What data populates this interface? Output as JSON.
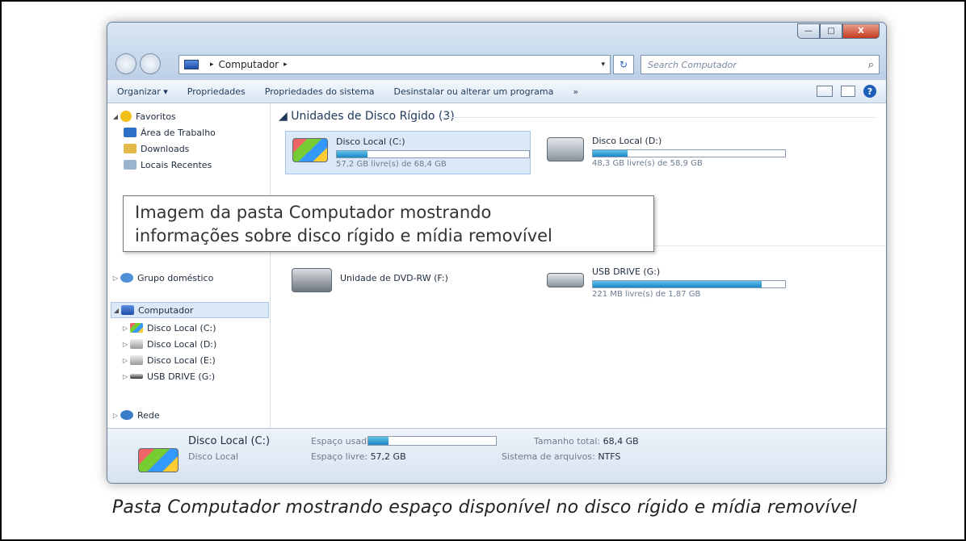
{
  "window": {
    "title_buttons": {
      "minimize": "—",
      "maximize": "□",
      "close": "X"
    },
    "address": {
      "path": [
        "Computador"
      ],
      "dropdown": "▾"
    },
    "search": {
      "placeholder": "Search Computador",
      "icon": "magnifier-icon"
    }
  },
  "toolbar": {
    "items": [
      "Organizar ▾",
      "Propriedades",
      "Propriedades do sistema",
      "Desinstalar ou alterar um programa",
      "»"
    ],
    "help_label": "?"
  },
  "nav": {
    "favoritos": "Favoritos",
    "fav_items": [
      "Área de Trabalho",
      "Downloads",
      "Locais Recentes"
    ],
    "grupo": "Grupo doméstico",
    "computador": "Computador",
    "comp_items": [
      "Disco Local (C:)",
      "Disco Local (D:)",
      "Disco Local (E:)",
      "USB DRIVE (G:)"
    ],
    "rede": "Rede"
  },
  "main": {
    "group1": "Unidades de Disco Rígido (3)",
    "drives": [
      {
        "name": "Disco Local (C:)",
        "free": "57,2 GB livre(s) de 68,4 GB",
        "used_fraction": 0.16
      },
      {
        "name": "Disco Local (D:)",
        "free": "48,3 GB livre(s) de 58,9 GB",
        "used_fraction": 0.18
      }
    ],
    "removable": [
      {
        "name": "Unidade de DVD-RW (F:)"
      },
      {
        "name": "USB DRIVE (G:)",
        "free": "221 MB livre(s) de 1,87 GB",
        "used_fraction": 0.88
      }
    ]
  },
  "tooltip": {
    "line1": "Imagem da pasta Computador mostrando",
    "line2": "informações sobre disco rígido e mídia removível"
  },
  "details": {
    "name": "Disco Local (C:)",
    "type": "Disco Local",
    "used_label": "Espaço usado:",
    "free_label": "Espaço livre:",
    "free_value": "57,2 GB",
    "total_label": "Tamanho total:",
    "total_value": "68,4 GB",
    "fs_label": "Sistema de arquivos:",
    "fs_value": "NTFS",
    "used_fraction": 0.16
  },
  "caption": "Pasta Computador mostrando espaço disponível no disco rígido e mídia removível",
  "colors": {
    "accent": "#1c86c4",
    "selection": "#dbe8f8"
  }
}
